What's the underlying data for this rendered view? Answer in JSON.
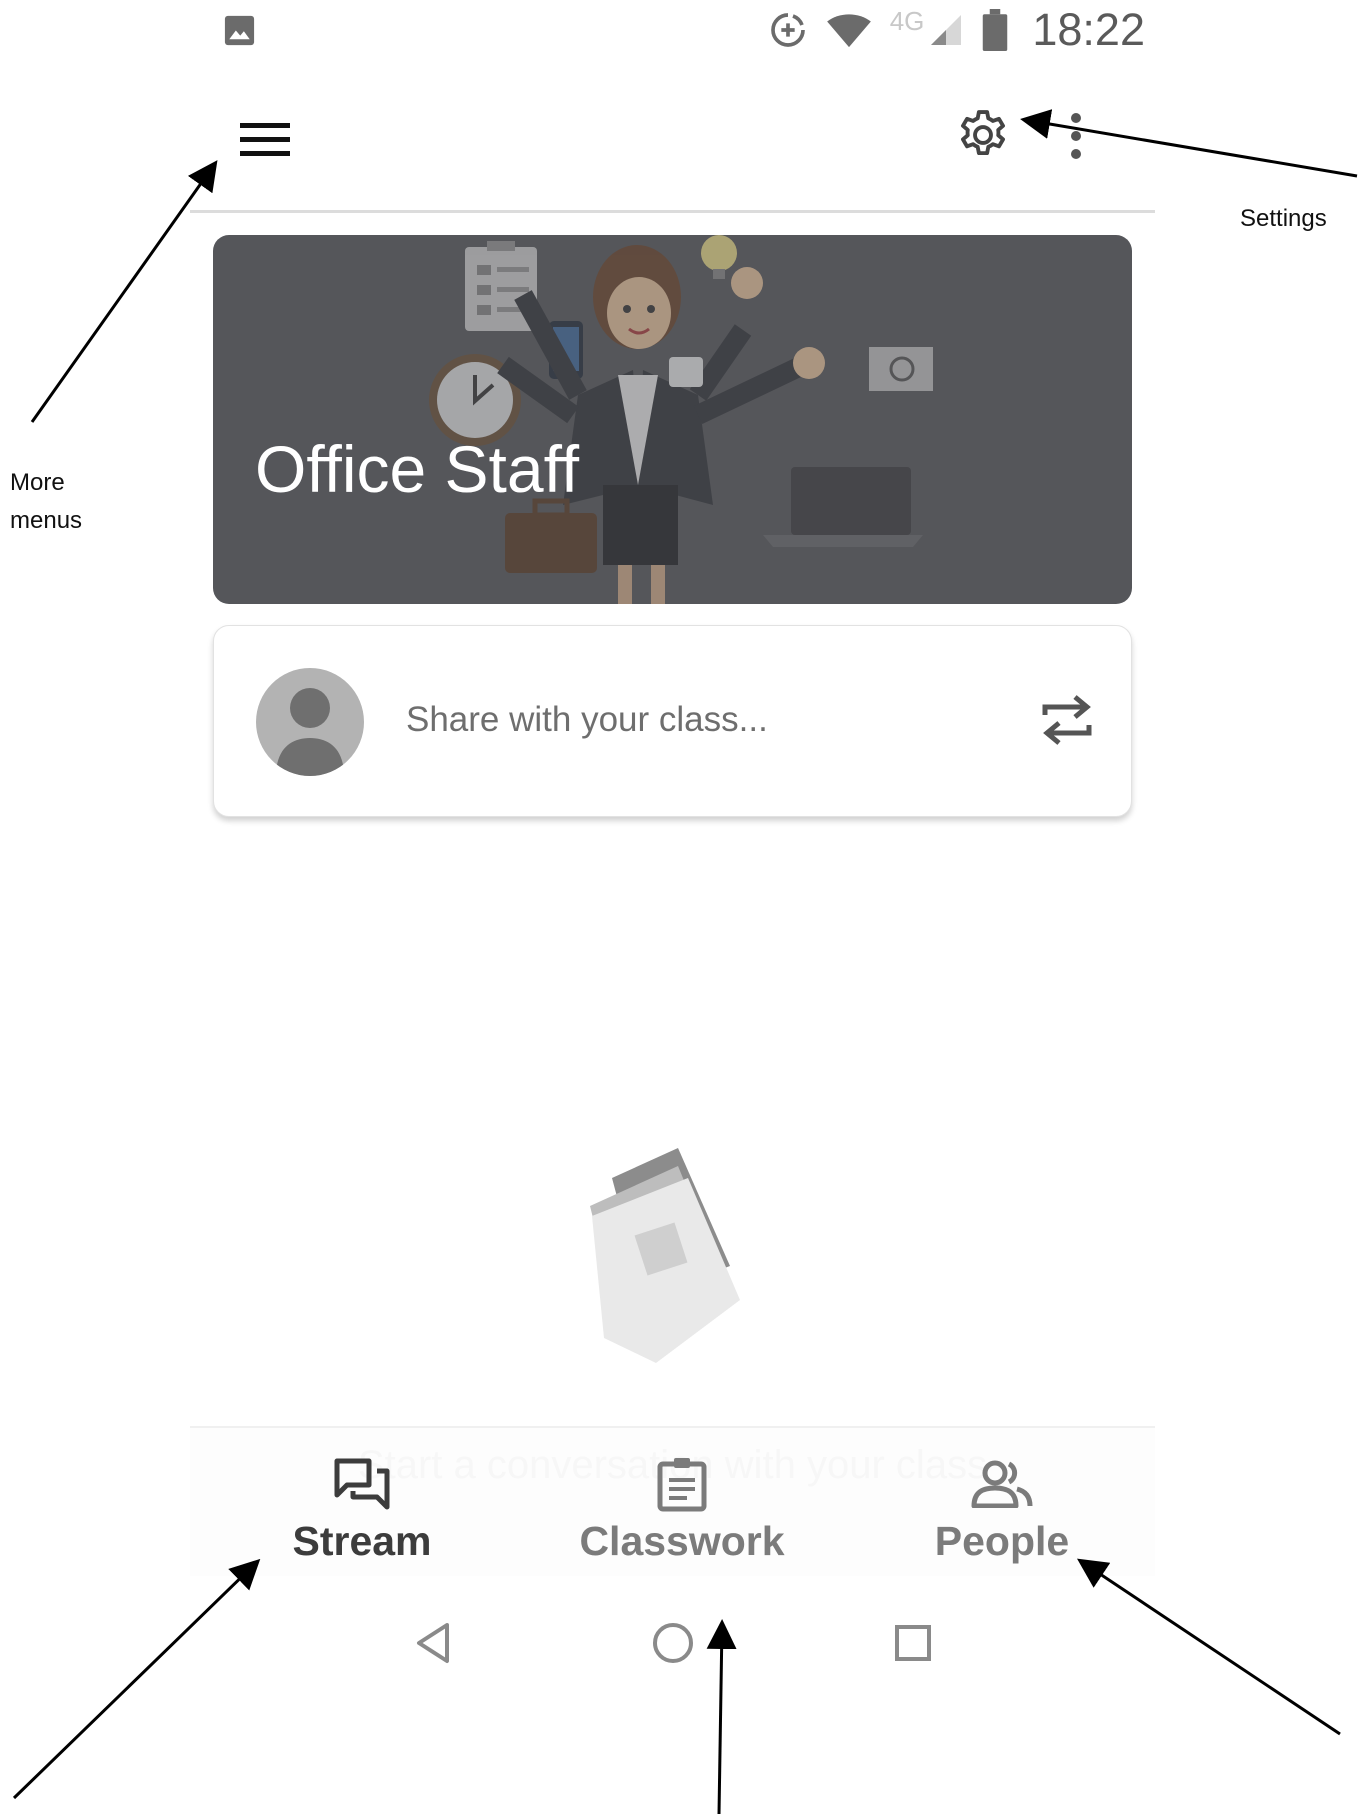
{
  "status_bar": {
    "time": "18:22",
    "network_label": "4G",
    "icons": [
      "gallery-icon",
      "data-saver-icon",
      "wifi-icon",
      "signal-icon",
      "battery-icon"
    ]
  },
  "app_bar": {
    "menu_icon": "hamburger-menu-icon",
    "settings_icon": "gear-icon",
    "more_icon": "more-vert-icon"
  },
  "banner": {
    "class_name": "Office Staff",
    "background_color": "#55565a"
  },
  "share": {
    "placeholder": "Share with your class...",
    "avatar_icon": "person-icon",
    "action_icon": "repost-icon"
  },
  "empty_state": {
    "hint": "Start a conversation with your class"
  },
  "bottom_nav": {
    "tabs": [
      {
        "label": "Stream",
        "icon": "forum-icon",
        "active": true
      },
      {
        "label": "Classwork",
        "icon": "assignment-icon",
        "active": false
      },
      {
        "label": "People",
        "icon": "people-icon",
        "active": false
      }
    ]
  },
  "system_nav": {
    "icons": [
      "back-icon",
      "home-icon",
      "recents-icon"
    ]
  },
  "annotations": {
    "more_menus_line1": "More",
    "more_menus_line2": "menus",
    "settings": "Settings"
  }
}
